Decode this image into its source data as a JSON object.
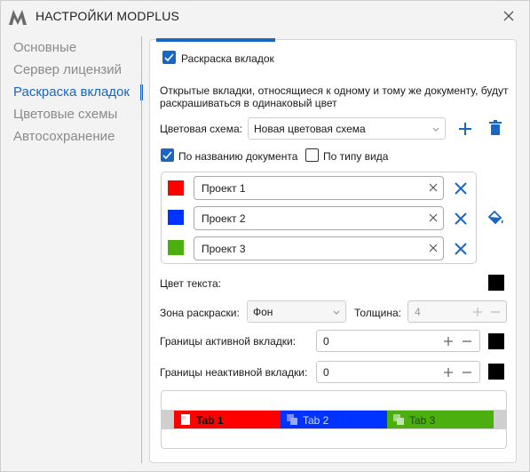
{
  "window": {
    "title": "НАСТРОЙКИ MODPLUS"
  },
  "sidebar": {
    "items": [
      {
        "label": "Основные"
      },
      {
        "label": "Сервер лицензий"
      },
      {
        "label": "Раскраска вкладок"
      },
      {
        "label": "Цветовые схемы"
      },
      {
        "label": "Автосохранение"
      }
    ],
    "active_index": 2
  },
  "main": {
    "enable_checkbox": {
      "label": "Раскраска вкладок",
      "checked": true
    },
    "description": "Открытые вкладки, относящиеся к одному и тому же документу, будут раскрашиваться в одинаковый цвет",
    "color_scheme": {
      "label": "Цветовая схема:",
      "value": "Новая цветовая схема"
    },
    "by_doc_name": {
      "label": "По названию документа",
      "checked": true
    },
    "by_view_type": {
      "label": "По типу вида",
      "checked": false
    },
    "rules": [
      {
        "color": "#ff0000",
        "value": "Проект 1"
      },
      {
        "color": "#0033ff",
        "value": "Проект 2"
      },
      {
        "color": "#4caf10",
        "value": "Проект 3"
      }
    ],
    "text_color": {
      "label": "Цвет текста:",
      "color": "#000000"
    },
    "fill_zone": {
      "label": "Зона раскраски:",
      "value": "Фон"
    },
    "thickness": {
      "label": "Толщина:",
      "value": "4"
    },
    "active_border": {
      "label": "Границы активной вкладки:",
      "value": "0",
      "color": "#000000"
    },
    "inactive_border": {
      "label": "Границы неактивной вкладки:",
      "value": "0",
      "color": "#000000"
    },
    "preview_tabs": [
      {
        "label": "Tab 1",
        "color": "#ff0000",
        "active": true
      },
      {
        "label": "Tab 2",
        "color": "#0033ff",
        "active": false
      },
      {
        "label": "Tab 3",
        "color": "#4caf10",
        "active": false
      }
    ]
  },
  "colors": {
    "accent": "#1a66c4",
    "delete": "#1a66c4"
  }
}
